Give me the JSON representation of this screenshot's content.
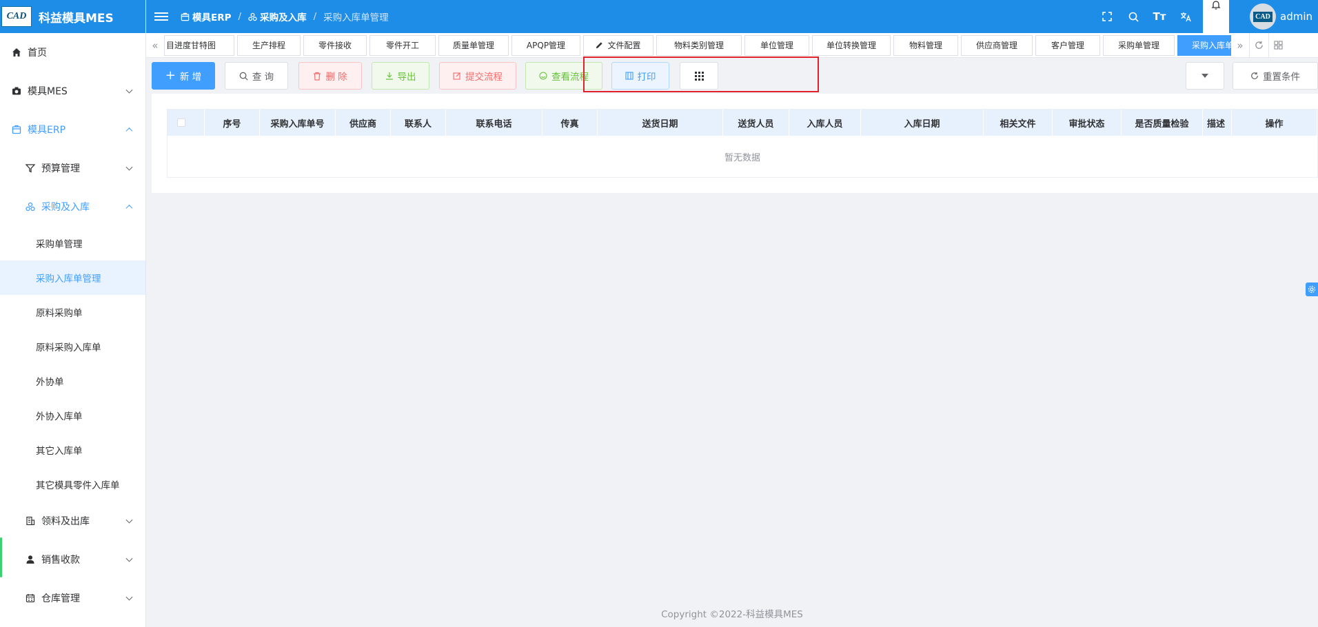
{
  "app": {
    "logo_badge": "CAD",
    "title": "科益模具MES"
  },
  "sidebar": {
    "home": "首页",
    "mes": "模具MES",
    "erp": "模具ERP",
    "budget": "预算管理",
    "purchase": "采购及入库",
    "sub_items": [
      "采购单管理",
      "采购入库单管理",
      "原料采购单",
      "原料采购入库单",
      "外协单",
      "外协入库单",
      "其它入库单",
      "其它模具零件入库单"
    ],
    "material_out": "领料及出库",
    "sales": "销售收款",
    "warehouse": "仓库管理"
  },
  "header": {
    "breadcrumb": [
      "模具ERP",
      "采购及入库",
      "采购入库单管理"
    ],
    "username": "admin"
  },
  "tabs": [
    "目进度甘特图",
    "生产排程",
    "零件接收",
    "零件开工",
    "质量单管理",
    "APQP管理",
    "文件配置",
    "物料类别管理",
    "单位管理",
    "单位转换管理",
    "物料管理",
    "供应商管理",
    "客户管理",
    "采购单管理",
    "采购入库单管理"
  ],
  "toolbar": {
    "add": "新 增",
    "query": "查 询",
    "delete": "删 除",
    "export": "导出",
    "submit_flow": "提交流程",
    "view_flow": "查看流程",
    "print": "打印",
    "reset": "重置条件"
  },
  "table": {
    "columns": [
      "序号",
      "采购入库单号",
      "供应商",
      "联系人",
      "联系电话",
      "传真",
      "送货日期",
      "送货人员",
      "入库人员",
      "入库日期",
      "相关文件",
      "审批状态",
      "是否质量检验",
      "描述",
      "操作"
    ],
    "empty_text": "暂无数据"
  },
  "footer": "Copyright ©2022-科益模具MES",
  "colors": {
    "header_blue": "#1e8de8",
    "primary": "#409eff",
    "danger": "#f56c6c",
    "success": "#67c23a",
    "highlight_red": "#e0212b"
  }
}
